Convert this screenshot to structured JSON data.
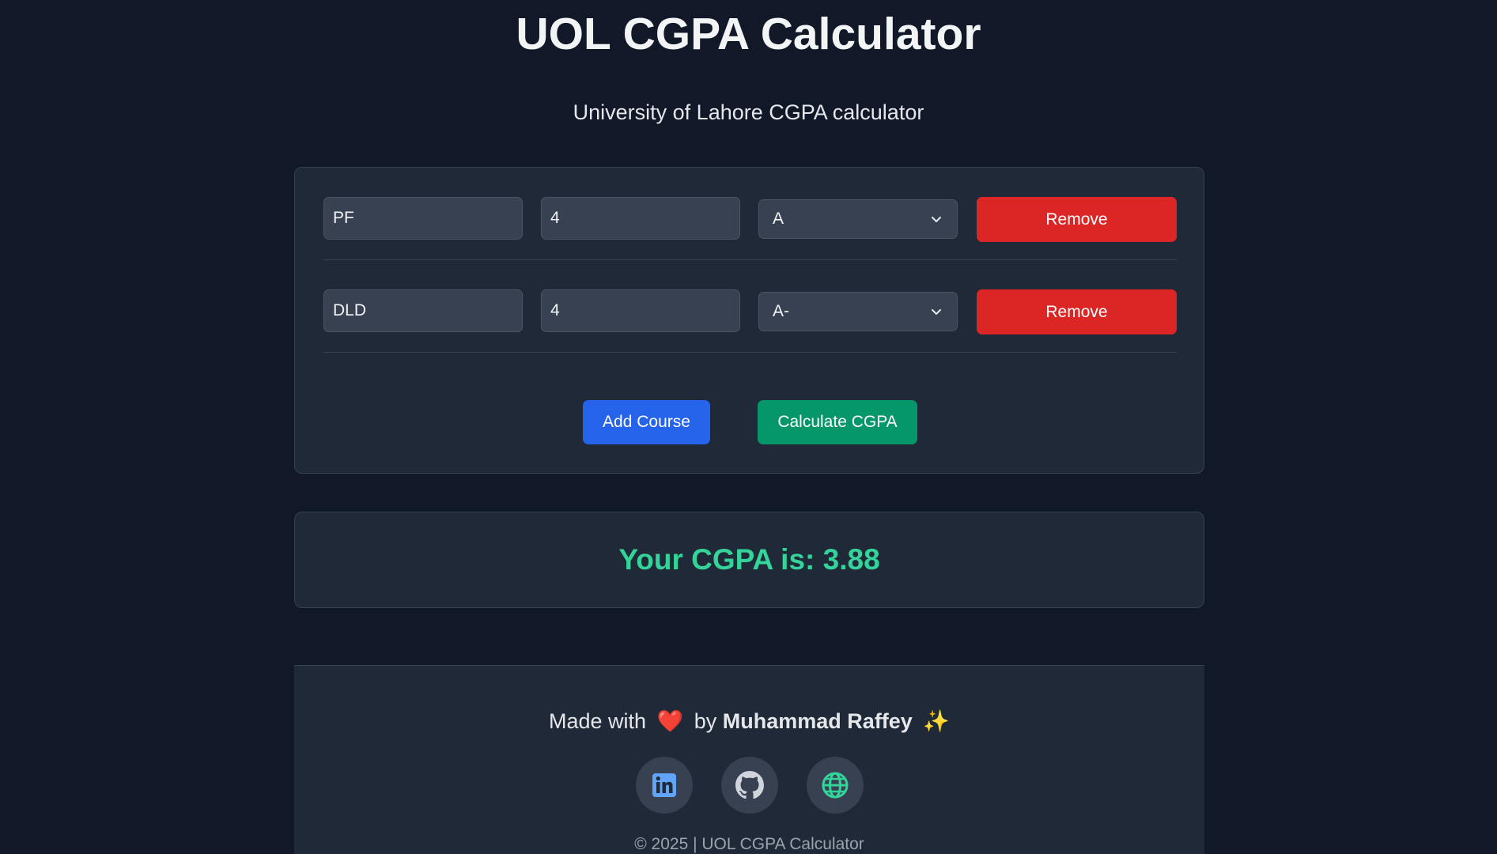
{
  "header": {
    "title": "UOL CGPA Calculator",
    "subtitle": "University of Lahore CGPA calculator"
  },
  "courses": [
    {
      "name": "PF",
      "credit_hours": "4",
      "grade": "A",
      "remove_label": "Remove"
    },
    {
      "name": "DLD",
      "credit_hours": "4",
      "grade": "A-",
      "remove_label": "Remove"
    }
  ],
  "actions": {
    "add_label": "Add Course",
    "calculate_label": "Calculate CGPA"
  },
  "result": {
    "text": "Your CGPA is: 3.88"
  },
  "footer": {
    "made_with": "Made with",
    "heart": "❤️",
    "by": "by",
    "author": "Muhammad Raffey",
    "sparkle": "✨",
    "socials": [
      "linkedin-icon",
      "github-icon",
      "globe-icon"
    ],
    "copyright": "© 2025 | UOL CGPA Calculator"
  },
  "colors": {
    "background": "#111827",
    "card": "#1f2937",
    "remove": "#dc2626",
    "add": "#2563eb",
    "calculate": "#059669",
    "result": "#34d399"
  }
}
